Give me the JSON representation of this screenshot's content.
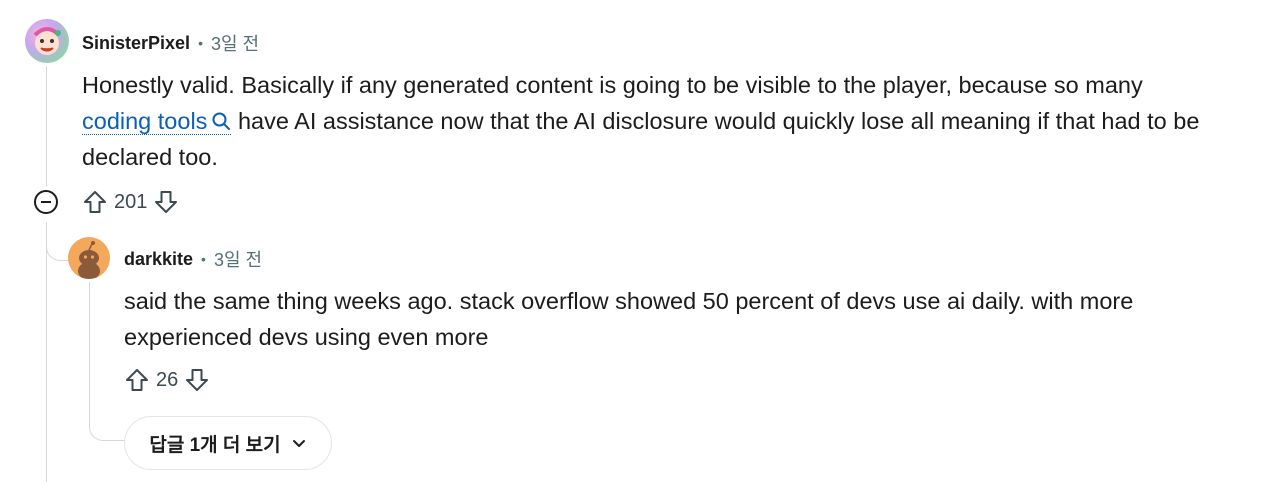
{
  "comment": {
    "username": "SinisterPixel",
    "separator": "•",
    "time": "3일 전",
    "body_line1": "Honestly valid. Basically if any generated content is going to be visible to the player, because so many",
    "link_text": "coding tools",
    "body_line2_rest": " have AI assistance now that the AI disclosure would quickly lose all meaning if that had to be",
    "body_line3": "declared too.",
    "score": "201"
  },
  "reply": {
    "username": "darkkite",
    "separator": "•",
    "time": "3일 전",
    "body_line1": "said the same thing weeks ago. stack overflow showed 50 percent of devs use ai daily. with more",
    "body_line2": "experienced devs using even more",
    "score": "26"
  },
  "more_replies_label": "답글 1개 더 보기",
  "colors": {
    "link": "#0a5fb8",
    "meta": "#576f76",
    "thread_line": "#d4d8db",
    "reply_avatar": "#f3a85c"
  },
  "icons": [
    "upvote-icon",
    "downvote-icon",
    "collapse-icon",
    "search-icon",
    "chevron-down-icon"
  ]
}
